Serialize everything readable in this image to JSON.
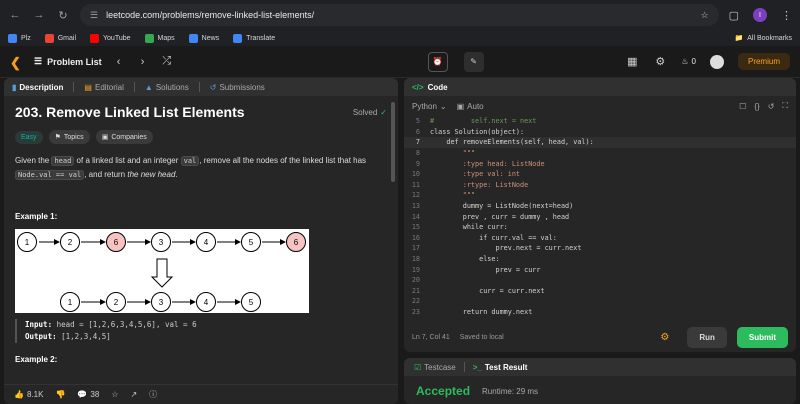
{
  "browser": {
    "url": "leetcode.com/problems/remove-linked-list-elements/",
    "bookmarks": [
      {
        "label": "Plz",
        "color": "#4285f4"
      },
      {
        "label": "Gmail",
        "color": "#ea4335"
      },
      {
        "label": "YouTube",
        "color": "#ff0000"
      },
      {
        "label": "Maps",
        "color": "#34a853"
      },
      {
        "label": "News",
        "color": "#4285f4"
      },
      {
        "label": "Translate",
        "color": "#4285f4"
      }
    ],
    "all_bookmarks": "All Bookmarks",
    "profile_initial": "I"
  },
  "header": {
    "problem_list": "Problem List",
    "streak": "0",
    "premium": "Premium"
  },
  "left": {
    "tabs": [
      "Description",
      "Editorial",
      "Solutions",
      "Submissions"
    ],
    "title": "203. Remove Linked List Elements",
    "solved": "Solved",
    "tags": [
      "Easy",
      "Topics",
      "Companies"
    ],
    "para": {
      "p1": "Given the ",
      "head": "head",
      "p2": " of a linked list and an integer ",
      "val": "val",
      "p3": ", remove all the nodes of the linked list that has ",
      "nodeval": "Node.val == val",
      "p4": ", and return ",
      "em": "the new head",
      "p5": "."
    },
    "example1": "Example 1:",
    "diagram_top": [
      "1",
      "2",
      "6",
      "3",
      "4",
      "5",
      "6"
    ],
    "diagram_bottom": [
      "1",
      "2",
      "3",
      "4",
      "5"
    ],
    "input_label": "Input:",
    "input_value": " head = [1,2,6,3,4,5,6], val = 6",
    "output_label": "Output:",
    "output_value": " [1,2,3,4,5]",
    "example2": "Example 2:",
    "likes": "8.1K",
    "comments": "38"
  },
  "code": {
    "title": "Code",
    "language": "Python",
    "auto": "Auto",
    "lines": [
      {
        "n": "5",
        "text": "#         self.next = next",
        "cls": "cm"
      },
      {
        "n": "6",
        "text": "class Solution(object):",
        "cls": "t"
      },
      {
        "n": "7",
        "text": "    def removeElements(self, head, val):",
        "cls": "t"
      },
      {
        "n": "8",
        "text": "        \"\"\"",
        "cls": "str"
      },
      {
        "n": "9",
        "text": "        :type head: ListNode",
        "cls": "str"
      },
      {
        "n": "10",
        "text": "        :type val: int",
        "cls": "str"
      },
      {
        "n": "11",
        "text": "        :rtype: ListNode",
        "cls": "str"
      },
      {
        "n": "12",
        "text": "        \"\"\"",
        "cls": "str"
      },
      {
        "n": "13",
        "text": "        dummy = ListNode(next=head)",
        "cls": "t"
      },
      {
        "n": "14",
        "text": "        prev , curr = dummy , head",
        "cls": "t"
      },
      {
        "n": "15",
        "text": "        while curr:",
        "cls": "t"
      },
      {
        "n": "16",
        "text": "            if curr.val == val:",
        "cls": "t"
      },
      {
        "n": "17",
        "text": "                prev.next = curr.next",
        "cls": "t"
      },
      {
        "n": "18",
        "text": "            else:",
        "cls": "t"
      },
      {
        "n": "19",
        "text": "                prev = curr",
        "cls": "t"
      },
      {
        "n": "20",
        "text": "",
        "cls": "t"
      },
      {
        "n": "21",
        "text": "            curr = curr.next",
        "cls": "t"
      },
      {
        "n": "22",
        "text": "",
        "cls": "t"
      },
      {
        "n": "23",
        "text": "        return dummy.next",
        "cls": "t"
      }
    ],
    "cursor": "Ln 7, Col 41",
    "saved": "Saved to local",
    "run": "Run",
    "submit": "Submit"
  },
  "test": {
    "tabs": [
      "Testcase",
      "Test Result"
    ],
    "status": "Accepted",
    "runtime": "Runtime: 29 ms"
  }
}
